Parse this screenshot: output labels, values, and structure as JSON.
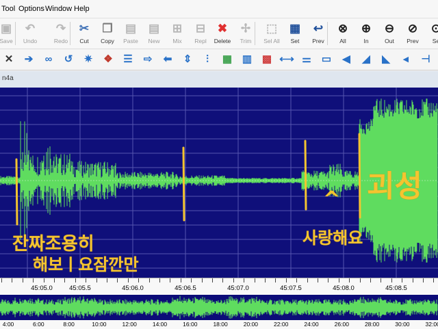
{
  "menu": [
    "Tool",
    "Options",
    "Window",
    "Help"
  ],
  "toolbar": [
    {
      "label": "Save",
      "glyph": "▣",
      "color": "#9a9a9a",
      "disabled": true
    },
    {
      "label": "Undo",
      "glyph": "↶",
      "color": "#7a9ac0",
      "disabled": true
    },
    {
      "label": "Redo",
      "glyph": "↷",
      "color": "#7a9ac0",
      "disabled": true
    },
    {
      "label": "Cut",
      "glyph": "✂",
      "color": "#3c6fb5",
      "disabled": false
    },
    {
      "label": "Copy",
      "glyph": "❐",
      "color": "#7a7a7a",
      "disabled": false
    },
    {
      "label": "Paste",
      "glyph": "▤",
      "color": "#b5b5b5",
      "disabled": true
    },
    {
      "label": "New",
      "glyph": "▤",
      "color": "#b5b5b5",
      "disabled": true
    },
    {
      "label": "Mix",
      "glyph": "⊞",
      "color": "#b5b5b5",
      "disabled": true
    },
    {
      "label": "Repl",
      "glyph": "⊟",
      "color": "#b5b5b5",
      "disabled": true
    },
    {
      "label": "Delete",
      "glyph": "✖",
      "color": "#e03030",
      "disabled": false
    },
    {
      "label": "Trim",
      "glyph": "✢",
      "color": "#b5b5b5",
      "disabled": true
    },
    {
      "label": "Sel All",
      "glyph": "⬚",
      "color": "#b5b5b5",
      "disabled": true
    },
    {
      "label": "Set",
      "glyph": "▦",
      "color": "#1f4f9a",
      "disabled": false
    },
    {
      "label": "Prev",
      "glyph": "↩",
      "color": "#1f4f9a",
      "disabled": false
    },
    {
      "label": "All",
      "glyph": "⊗",
      "color": "#222222",
      "disabled": false
    },
    {
      "label": "In",
      "glyph": "⊕",
      "color": "#222222",
      "disabled": false
    },
    {
      "label": "Out",
      "glyph": "⊖",
      "color": "#222222",
      "disabled": false
    },
    {
      "label": "Prev",
      "glyph": "⊘",
      "color": "#222222",
      "disabled": false
    },
    {
      "label": "Se",
      "glyph": "⊙",
      "color": "#222222",
      "disabled": false
    }
  ],
  "toolbar2": [
    {
      "icon": "cross-icon",
      "glyph": "✕",
      "color": "#333333"
    },
    {
      "icon": "arrow-right-icon",
      "glyph": "➔",
      "color": "#2a72c8"
    },
    {
      "icon": "loop-icon",
      "glyph": "∞",
      "color": "#2a72c8"
    },
    {
      "icon": "return-icon",
      "glyph": "↺",
      "color": "#2a72c8"
    },
    {
      "icon": "gear-icon",
      "glyph": "✷",
      "color": "#2a72c8"
    },
    {
      "icon": "palette-icon",
      "glyph": "❖",
      "color": "#c0392b"
    },
    {
      "icon": "list-icon",
      "glyph": "☰",
      "color": "#2a72c8"
    },
    {
      "icon": "forward-icon",
      "glyph": "⇨",
      "color": "#2a72c8"
    },
    {
      "icon": "back-icon",
      "glyph": "⬅",
      "color": "#2a72c8"
    },
    {
      "icon": "updown-icon",
      "glyph": "⇕",
      "color": "#2a72c8"
    },
    {
      "icon": "equalizer-icon",
      "glyph": "⫶",
      "color": "#2a72c8"
    },
    {
      "icon": "spectrum-icon",
      "glyph": "▦",
      "color": "#3aa04a"
    },
    {
      "icon": "bars-icon",
      "glyph": "▥",
      "color": "#2a72c8"
    },
    {
      "icon": "color-bars-icon",
      "glyph": "▩",
      "color": "#d04040"
    },
    {
      "icon": "reverse-icon",
      "glyph": "⟷",
      "color": "#2a72c8"
    },
    {
      "icon": "bed-icon",
      "glyph": "⚌",
      "color": "#2a72c8"
    },
    {
      "icon": "box-icon",
      "glyph": "▭",
      "color": "#2a72c8"
    },
    {
      "icon": "volume-icon",
      "glyph": "◀",
      "color": "#2a72c8"
    },
    {
      "icon": "fade-in-icon",
      "glyph": "◢",
      "color": "#2a72c8"
    },
    {
      "icon": "fade-out-icon",
      "glyph": "◣",
      "color": "#2a72c8"
    },
    {
      "icon": "speaker-icon",
      "glyph": "◂",
      "color": "#2a72c8"
    },
    {
      "icon": "speaker-minus-icon",
      "glyph": "⊣",
      "color": "#2a72c8"
    }
  ],
  "doc_tab": "n4a",
  "colors": {
    "wave_bg": "#0f0f7a",
    "wave": "#5fdc5f",
    "grid": "#5656b0",
    "overview_bg": "#0c0c78",
    "marker": "#f4c430"
  },
  "ruler": [
    "45:05.0",
    "45:05.5",
    "45:06.0",
    "45:06.5",
    "45:07.0",
    "45:07.5",
    "45:08.0",
    "45:08.5"
  ],
  "overview_ruler": [
    "4:00",
    "6:00",
    "8:00",
    "10:00",
    "12:00",
    "14:00",
    "16:00",
    "18:00",
    "20:00",
    "22:00",
    "24:00",
    "26:00",
    "28:00",
    "30:00",
    "32:00"
  ],
  "annotations": {
    "line1": "잔짜조용히",
    "line2": "해보ㅣ요잠깐만",
    "love": "사랑해요",
    "caret": "^",
    "weird": "괴성"
  }
}
